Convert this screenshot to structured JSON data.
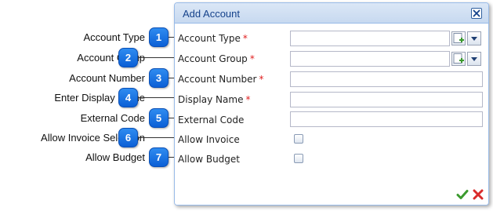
{
  "dialog": {
    "title": "Add Account",
    "close_icon": "close-x-icon"
  },
  "callouts": [
    {
      "number": "1",
      "label": "Account Type"
    },
    {
      "number": "2",
      "label": "Account Group"
    },
    {
      "number": "3",
      "label": "Account Number"
    },
    {
      "number": "4",
      "label": "Enter Display Name"
    },
    {
      "number": "5",
      "label": "External Code"
    },
    {
      "number": "6",
      "label": "Allow Invoice Selection"
    },
    {
      "number": "7",
      "label": "Allow Budget"
    }
  ],
  "form": {
    "account_type": {
      "label": "Account Type",
      "required": "*",
      "value": ""
    },
    "account_group": {
      "label": "Account Group",
      "required": "*",
      "value": ""
    },
    "account_number": {
      "label": "Account Number",
      "required": "*",
      "value": ""
    },
    "display_name": {
      "label": "Display Name",
      "required": "*",
      "value": ""
    },
    "external_code": {
      "label": "External Code",
      "value": ""
    },
    "allow_invoice": {
      "label": "Allow Invoice",
      "checked": false
    },
    "allow_budget": {
      "label": "Allow Budget",
      "checked": false
    }
  },
  "footer": {
    "save_icon": "checkmark-icon",
    "cancel_icon": "red-x-icon"
  },
  "colors": {
    "badge": "#1e74e4",
    "title_bar": "#c7d9f0",
    "title_text": "#15428b",
    "required": "#e02020",
    "check": "#3b9a2e",
    "cancel": "#d92b2b"
  }
}
